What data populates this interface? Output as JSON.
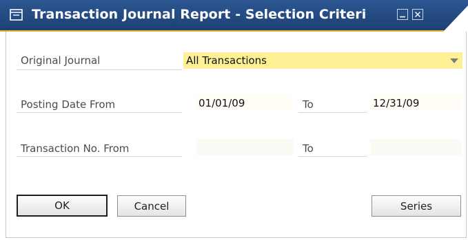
{
  "window": {
    "title": "Transaction Journal Report - Selection Criteri",
    "icons": {
      "title": "form-icon",
      "minimize": "minimize-icon",
      "close": "close-icon"
    },
    "colors": {
      "title_bar": "#2c5792",
      "accent": "#e0b63f",
      "field_highlight": "#fdf095"
    }
  },
  "form": {
    "original_journal": {
      "label": "Original Journal",
      "value": "All Transactions"
    },
    "posting_date": {
      "label": "Posting Date From",
      "from": "01/01/09",
      "to_label": "To",
      "to": "12/31/09"
    },
    "transaction_no": {
      "label": "Transaction No. From",
      "from": "",
      "to_label": "To",
      "to": ""
    }
  },
  "buttons": {
    "ok": "OK",
    "cancel": "Cancel",
    "series": "Series"
  }
}
